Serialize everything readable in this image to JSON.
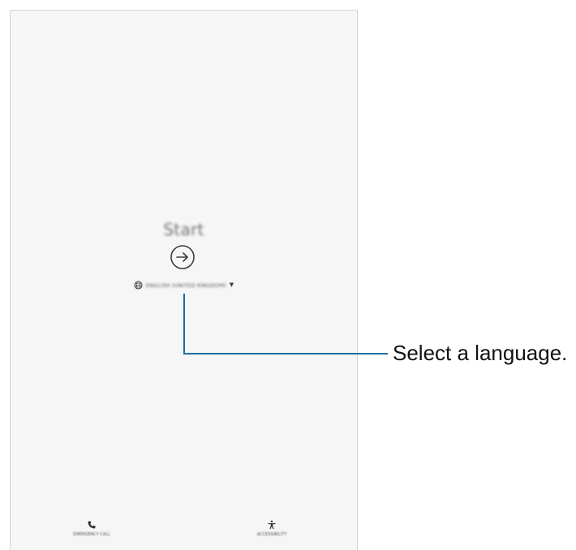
{
  "screen": {
    "title": "Start",
    "language_selector": {
      "selected_language": "ENGLISH (UNITED KINGDOM)",
      "globe_icon": "globe-icon",
      "dropdown_icon": "dropdown-arrow-icon"
    },
    "start_button_icon": "arrow-right-circle-icon",
    "bottom_actions": {
      "emergency_call_label": "EMERGENCY CALL",
      "emergency_call_icon": "phone-icon",
      "accessibility_label": "ACCESSIBILITY",
      "accessibility_icon": "accessibility-icon"
    }
  },
  "callout": {
    "text": "Select a language.",
    "line_color": "#1a6fa3"
  }
}
